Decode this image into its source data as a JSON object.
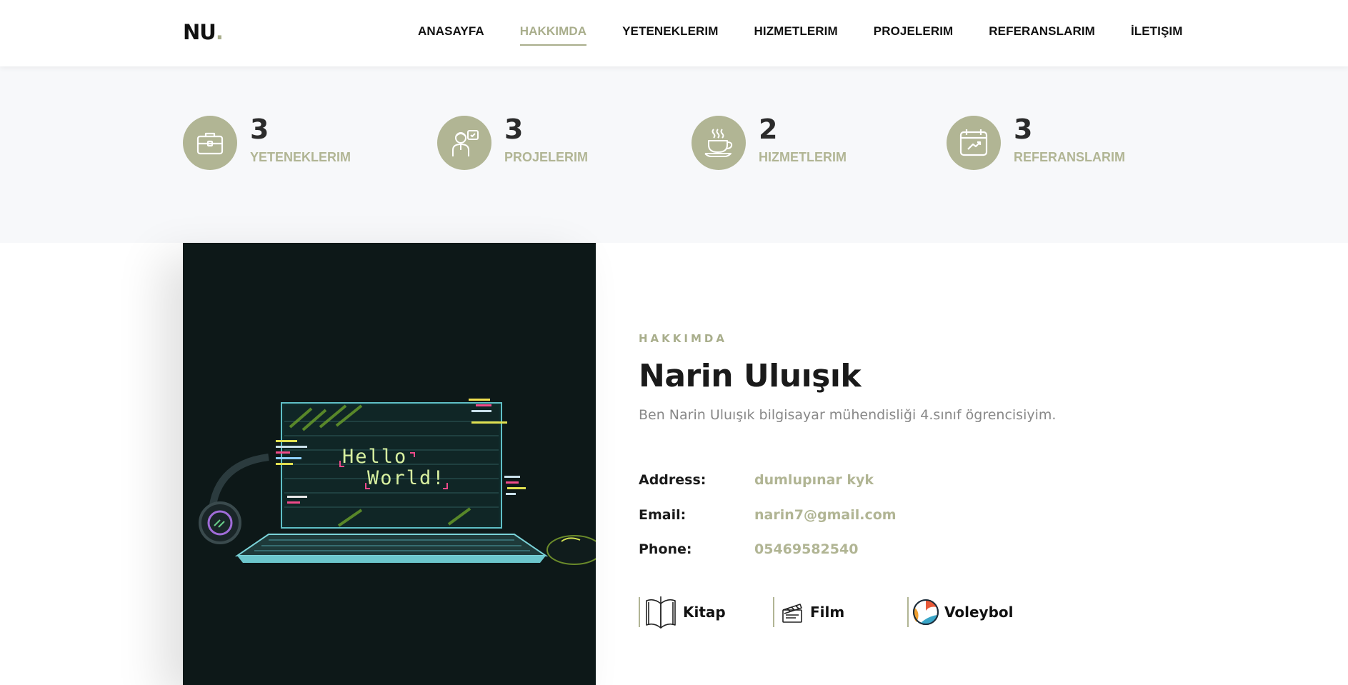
{
  "brand": {
    "text": "NU",
    "dot": "."
  },
  "nav": [
    {
      "label": "ANASAYFA",
      "active": false
    },
    {
      "label": "HAKKIMDA",
      "active": true
    },
    {
      "label": "YETENEKLERIM",
      "active": false
    },
    {
      "label": "HIZMETLERIM",
      "active": false
    },
    {
      "label": "PROJELERIM",
      "active": false
    },
    {
      "label": "REFERANSLARIM",
      "active": false
    },
    {
      "label": "İLETIŞIM",
      "active": false
    }
  ],
  "counters": [
    {
      "icon": "briefcase-icon",
      "value": "3",
      "label": "YETENEKLERIM"
    },
    {
      "icon": "developer-icon",
      "value": "3",
      "label": "PROJELERIM"
    },
    {
      "icon": "coffee-cup-icon",
      "value": "2",
      "label": "HIZMETLERIM"
    },
    {
      "icon": "calendar-chart-icon",
      "value": "3",
      "label": "REFERANSLARIM"
    }
  ],
  "photo": {
    "screen_text_1": "Hello",
    "screen_text_2": "World!"
  },
  "about": {
    "eyebrow": "HAKKIMDA",
    "name": "Narin Uluışık",
    "description": "Ben Narin Uluışık bilgisayar mühendisliği 4.sınıf ögrencisiyim."
  },
  "contact": [
    {
      "key": "Address:",
      "value": "dumlupınar kyk"
    },
    {
      "key": "Email:",
      "value": "narin7@gmail.com"
    },
    {
      "key": "Phone:",
      "value": "05469582540"
    }
  ],
  "hobbies": [
    {
      "icon": "book-icon",
      "label": "Kitap"
    },
    {
      "icon": "clapperboard-icon",
      "label": "Film"
    },
    {
      "icon": "volleyball-icon",
      "label": "Voleybol"
    }
  ],
  "colors": {
    "accent": "#b1b594",
    "text": "#1a1a1a",
    "muted": "#888888",
    "photo_bg": "#0d1818",
    "counter_bg": "#f7f8fa"
  }
}
